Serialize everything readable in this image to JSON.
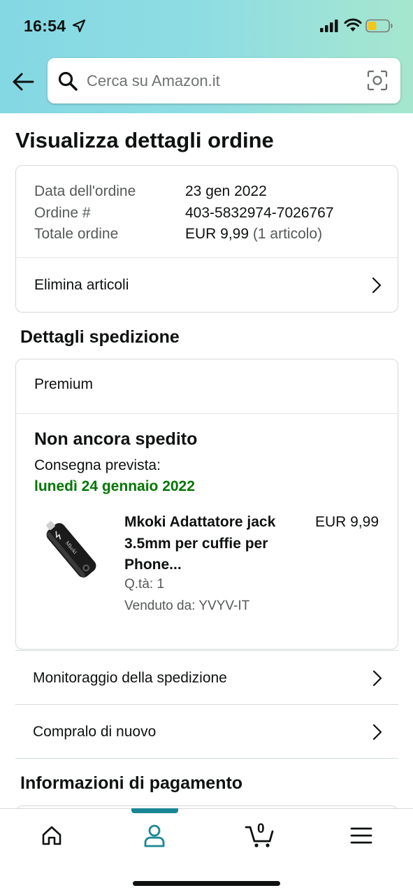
{
  "status_bar": {
    "time": "16:54"
  },
  "search": {
    "placeholder": "Cerca su Amazon.it"
  },
  "page": {
    "title": "Visualizza dettagli ordine"
  },
  "order_summary": {
    "rows": [
      {
        "label": "Data dell'ordine",
        "value": "23 gen 2022",
        "extra": ""
      },
      {
        "label": "Ordine #",
        "value": "403-5832974-7026767",
        "extra": ""
      },
      {
        "label": "Totale ordine",
        "value": "EUR 9,99",
        "extra": "(1 articolo)"
      }
    ],
    "remove_items_label": "Elimina articoli"
  },
  "shipping": {
    "section_title": "Dettagli spedizione",
    "service": "Premium",
    "status": "Non ancora spedito",
    "delivery_label": "Consegna prevista:",
    "delivery_date": "lunedì 24 gennaio 2022",
    "item": {
      "title": "Mkoki Adattatore jack 3.5mm per cuffie per Phone...",
      "price": "EUR 9,99",
      "quantity": "Q.tà: 1",
      "seller": "Venduto da: YVYV-IT",
      "image_brand_text": "Mkoki"
    }
  },
  "actions": {
    "track_label": "Monitoraggio della spedizione",
    "buy_again_label": "Compralo di nuovo"
  },
  "payment": {
    "section_title": "Informazioni di pagamento"
  },
  "bottom_nav": {
    "cart_count": "0",
    "active": "account",
    "accent_color": "#1a8694"
  },
  "colors": {
    "delivery_green": "#007600",
    "header_gradient_start": "#84d8e3",
    "header_gradient_end": "#a6e6ce"
  }
}
